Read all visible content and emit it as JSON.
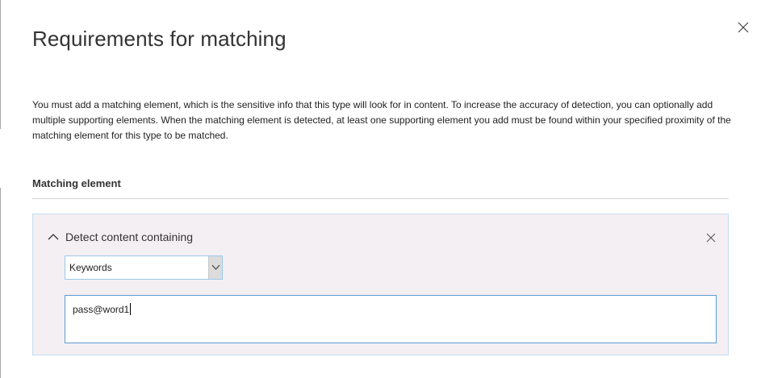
{
  "panel": {
    "title": "Requirements for matching",
    "close_icon": "close-icon",
    "description": "You must add a matching element, which is the sensitive info that this type will look for in content. To increase the accuracy of detection, you can optionally add multiple supporting elements. When the matching element is detected, at least one supporting element you add must be found within your specified proximity of the matching element for this type to be matched."
  },
  "matching_element": {
    "heading": "Matching element",
    "card": {
      "toggle_label": "Detect content containing",
      "toggle_icon": "chevron-up-icon",
      "remove_icon": "close-icon",
      "type_select": {
        "selected": "Keywords",
        "icon": "chevron-down-icon"
      },
      "keywords_value": "pass@word1"
    }
  },
  "colors": {
    "card_background": "#f4eff3",
    "card_border": "#c4ddf3",
    "input_border": "#5b9bd5",
    "text": "#333333"
  }
}
